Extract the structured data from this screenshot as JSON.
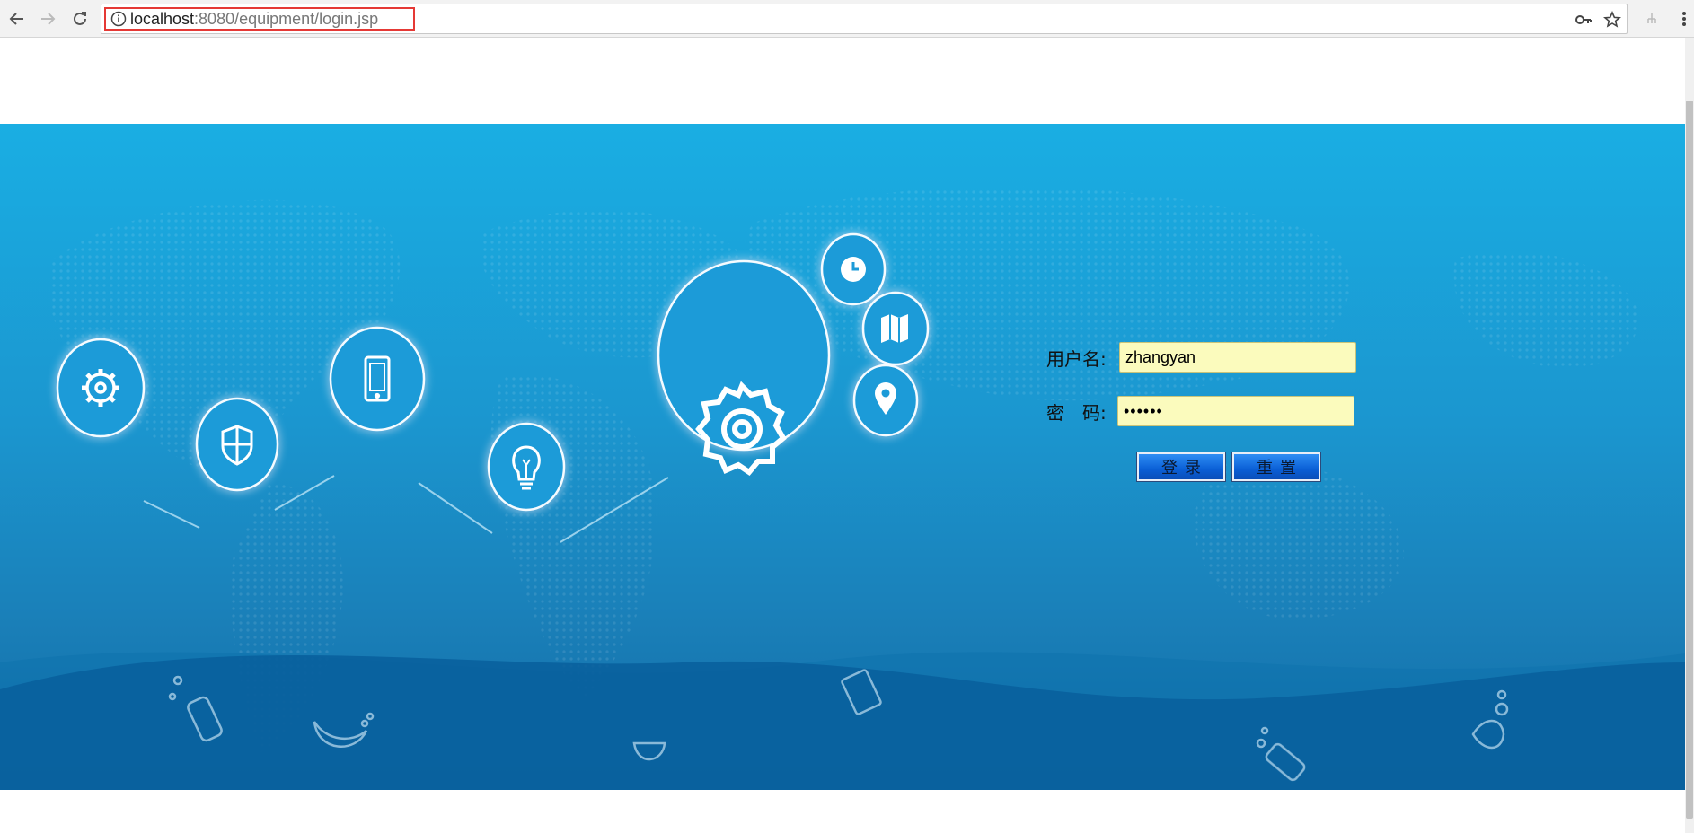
{
  "browser": {
    "url_host": "localhost",
    "url_rest": ":8080/equipment/login.jsp",
    "icons": {
      "back": "arrow-left-icon",
      "forward": "arrow-right-icon",
      "reload": "reload-icon",
      "info": "info-icon",
      "key": "key-icon",
      "bookmark": "star-icon",
      "extension": "extension-icon",
      "menu": "kebab-menu-icon"
    }
  },
  "login": {
    "username_label": "用户名:",
    "username_value": "zhangyan",
    "password_label": "密　码:",
    "password_value": "••••••",
    "login_button": "登录",
    "reset_button": "重置"
  },
  "colors": {
    "banner_top": "#1aaee3",
    "banner_bottom": "#0f6aa5",
    "input_bg": "#fbfbbd",
    "button_blue": "#0a5fd6",
    "url_highlight": "#e53935"
  }
}
